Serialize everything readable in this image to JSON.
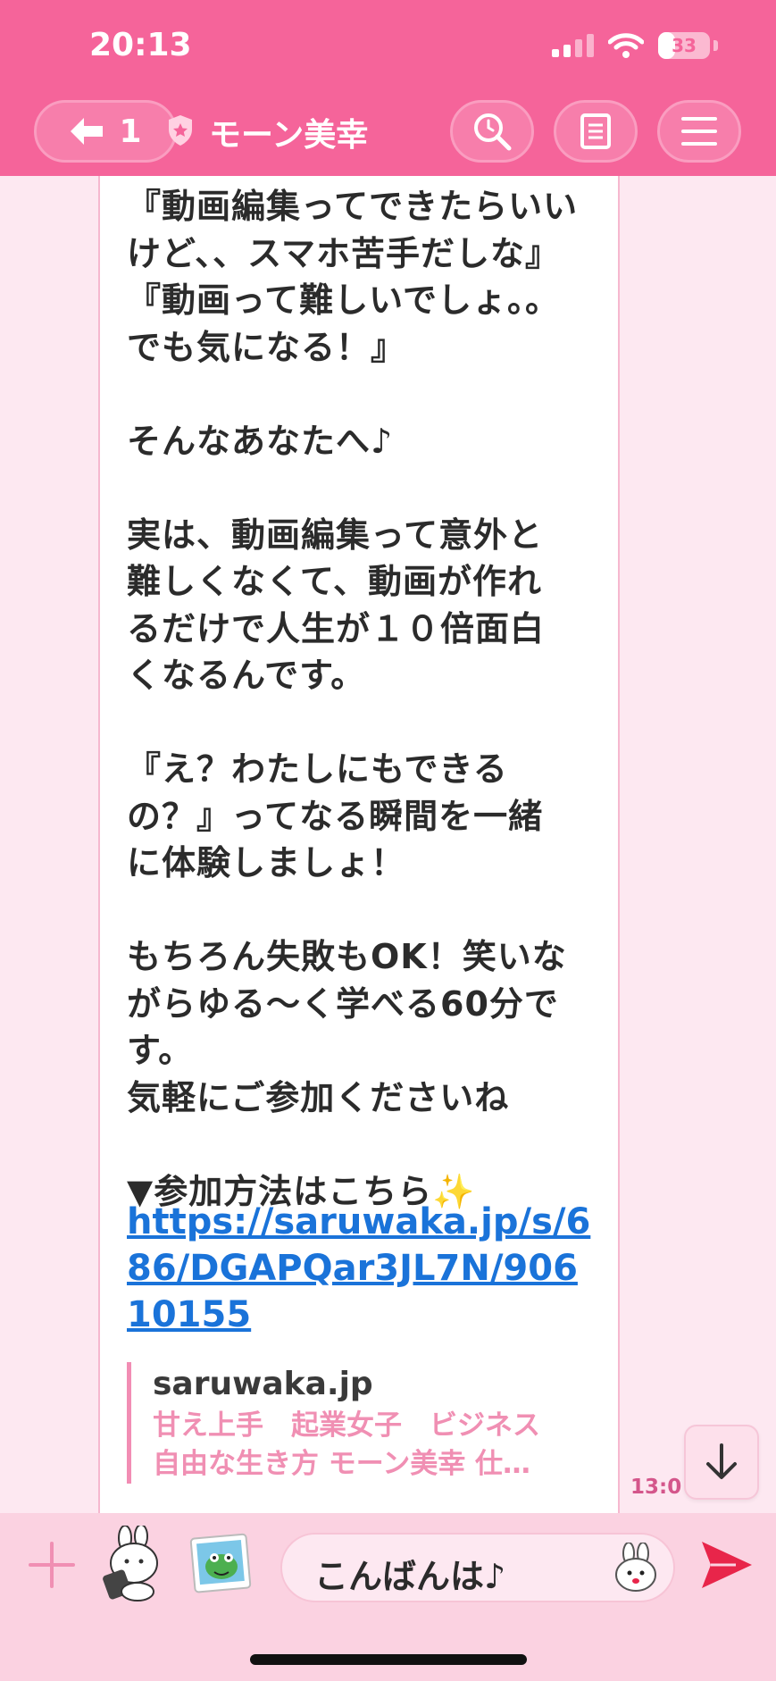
{
  "status_bar": {
    "time": "20:13",
    "battery": "33",
    "battery_level": 0.33
  },
  "header": {
    "back_count": "1",
    "title": "モーン美幸"
  },
  "message": {
    "text": "『動画編集ってできたらいい\nけど、、スマホ苦手だしな』\n『動画って難しいでしょ。。\nでも気になる！』\n\nそんなあなたへ♪\n\n実は、動画編集って意外と\n難しくなくて、動画が作れ\nるだけで人生が１０倍面白\nくなるんです。\n\n『え？わたしにもできる\nの？』ってなる瞬間を一緒\nに体験しましょ！\n\nもちろん失敗もOK！笑いな\nがらゆる〜く学べる60分で\nす。\n気軽にご参加くださいね\n\n▼参加方法はこちら✨",
    "link": "https://saruwaka.jp/s/686/DGAPQar3JL7N/90610155",
    "preview_domain": "saruwaka.jp",
    "preview_desc": "甘え上手　起業女子　ビジネス\n自由な生き方 モーン美幸 仕…",
    "time": "13:0"
  },
  "input": {
    "text": "こんばんは♪"
  },
  "colors": {
    "header": "#f5649a",
    "link": "#1a73d9",
    "preview_accent": "#f28db4",
    "send": "#e8254a"
  },
  "icons": [
    "back-arrow-icon",
    "shield-icon",
    "search-icon",
    "notes-icon",
    "menu-icon",
    "chevron-down-icon",
    "plus-icon",
    "sticker-icon",
    "photo-icon",
    "emoji-icon",
    "send-icon"
  ]
}
